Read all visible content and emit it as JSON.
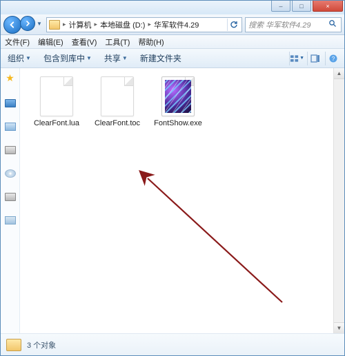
{
  "titlebar": {
    "minimize": "–",
    "maximize": "□",
    "close": "×"
  },
  "breadcrumb": {
    "root": "计算机",
    "drive": "本地磁盘 (D:)",
    "folder": "华军软件4.29"
  },
  "search": {
    "placeholder": "搜索 华军软件4.29"
  },
  "menu": {
    "file": "文件(F)",
    "edit": "编辑(E)",
    "view": "查看(V)",
    "tools": "工具(T)",
    "help": "帮助(H)"
  },
  "toolbar": {
    "organize": "组织",
    "include": "包含到库中",
    "share": "共享",
    "newfolder": "新建文件夹"
  },
  "files": [
    {
      "name": "ClearFont.lua",
      "type": "doc"
    },
    {
      "name": "ClearFont.toc",
      "type": "doc"
    },
    {
      "name": "FontShow.exe",
      "type": "exe"
    }
  ],
  "status": {
    "count_text": "3 个对象"
  }
}
